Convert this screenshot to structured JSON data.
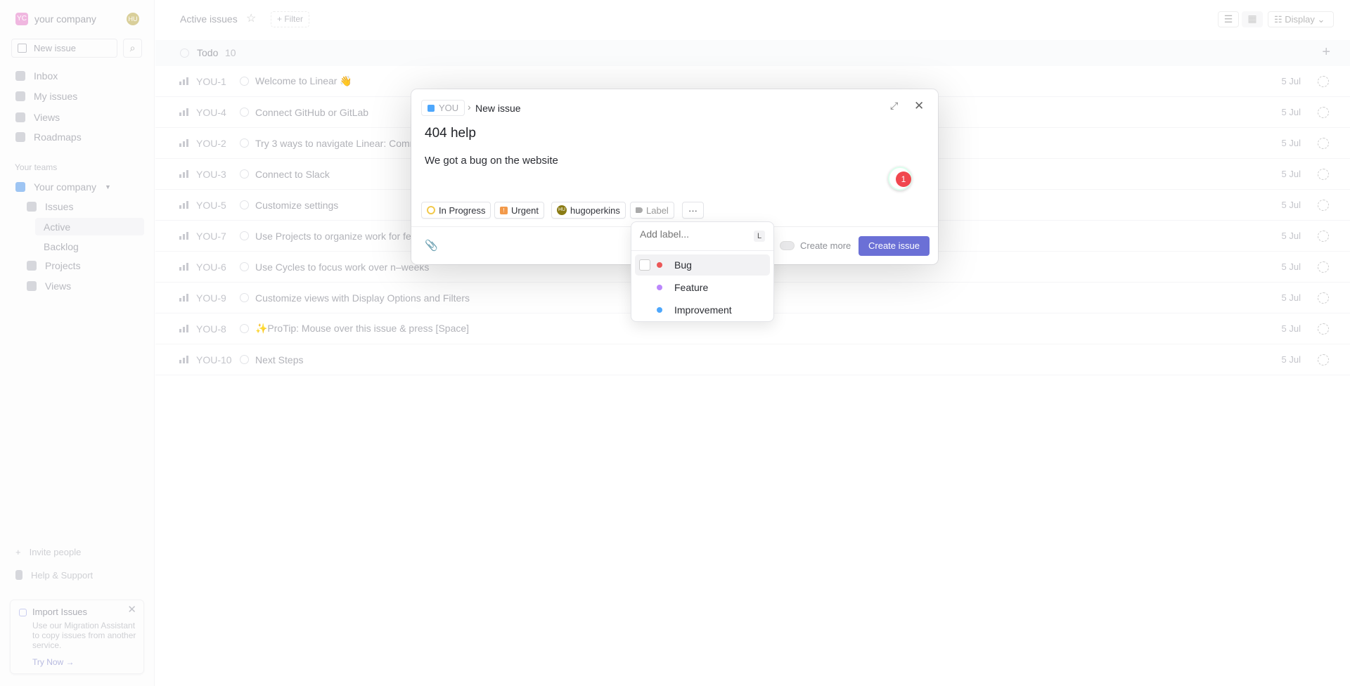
{
  "sidebar": {
    "workspace": "your company",
    "workspace_initials": "YC",
    "user_initials": "HU",
    "new_issue": "New issue",
    "nav": [
      "Inbox",
      "My issues",
      "Views",
      "Roadmaps"
    ],
    "teams_heading": "Your teams",
    "team": "Your company",
    "team_items": [
      "Issues",
      "Active",
      "Backlog",
      "Projects",
      "Views"
    ],
    "invite": "Invite people",
    "help": "Help & Support",
    "import": {
      "title": "Import Issues",
      "body": "Use our Migration Assistant to copy issues from another service.",
      "link": "Try Now →"
    }
  },
  "header": {
    "title": "Active issues",
    "filter": "Filter",
    "display": "Display"
  },
  "group": {
    "name": "Todo",
    "count": "10"
  },
  "issues": [
    {
      "id": "YOU-1",
      "title": "Welcome to Linear 👋",
      "date": "5 Jul"
    },
    {
      "id": "YOU-4",
      "title": "Connect GitHub or GitLab",
      "date": "5 Jul"
    },
    {
      "id": "YOU-2",
      "title": "Try 3 ways to navigate Linear: Comm",
      "date": "5 Jul"
    },
    {
      "id": "YOU-3",
      "title": "Connect to Slack",
      "date": "5 Jul"
    },
    {
      "id": "YOU-5",
      "title": "Customize settings",
      "date": "5 Jul"
    },
    {
      "id": "YOU-7",
      "title": "Use Projects to organize work for fe",
      "date": "5 Jul"
    },
    {
      "id": "YOU-6",
      "title": "Use Cycles to focus work over n–weeks",
      "date": "5 Jul"
    },
    {
      "id": "YOU-9",
      "title": "Customize views with Display Options and Filters",
      "date": "5 Jul"
    },
    {
      "id": "YOU-8",
      "title": "✨ProTip: Mouse over this issue & press [Space]",
      "date": "5 Jul"
    },
    {
      "id": "YOU-10",
      "title": "Next Steps",
      "date": "5 Jul"
    }
  ],
  "modal": {
    "team": "YOU",
    "breadcrumb": "New issue",
    "title": "404 help",
    "description": "We got a bug on the website",
    "badge_count": "1",
    "status": "In Progress",
    "priority": "Urgent",
    "assignee": "hugoperkins",
    "assignee_initials": "HU",
    "label": "Label",
    "create_more": "Create more",
    "create": "Create issue"
  },
  "label_menu": {
    "placeholder": "Add label...",
    "shortcut": "L",
    "options": [
      {
        "name": "Bug",
        "color": "#eb5757"
      },
      {
        "name": "Feature",
        "color": "#bb87fc"
      },
      {
        "name": "Improvement",
        "color": "#4ea7fc"
      }
    ]
  }
}
